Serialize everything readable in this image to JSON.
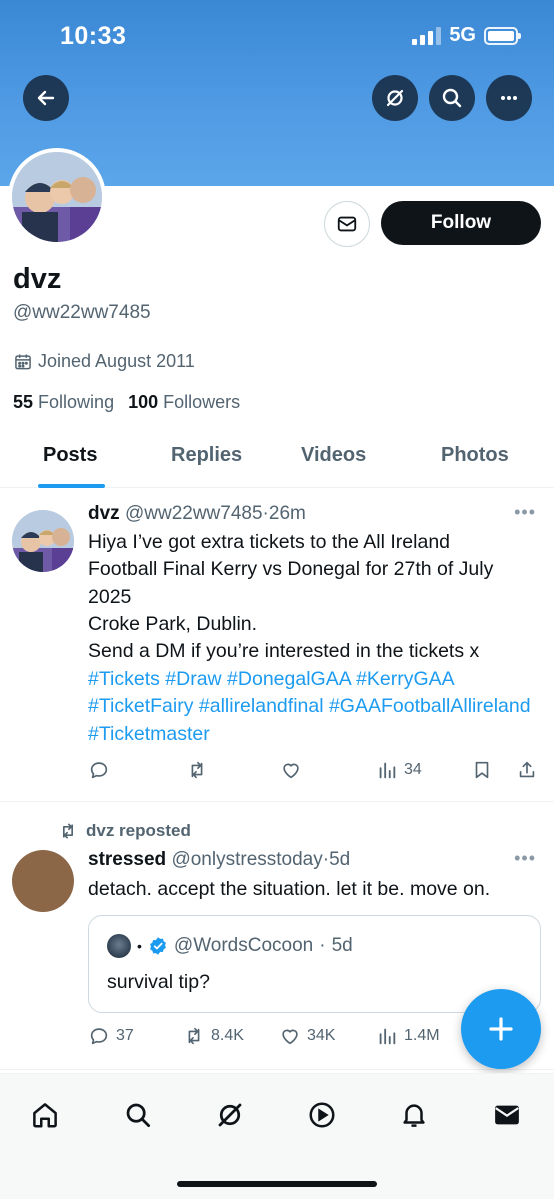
{
  "status_bar": {
    "time": "10:33",
    "network": "5G"
  },
  "header": {
    "icons": [
      "back-arrow-icon",
      "grok-icon",
      "search-icon",
      "more-icon"
    ]
  },
  "profile": {
    "name": "dvz",
    "handle": "@ww22ww7485",
    "joined": "Joined August 2011",
    "following_count": "55",
    "following_label": "Following",
    "followers_count": "100",
    "followers_label": "Followers",
    "follow_button": "Follow"
  },
  "tabs": [
    {
      "label": "Posts",
      "active": true
    },
    {
      "label": "Replies",
      "active": false
    },
    {
      "label": "Videos",
      "active": false
    },
    {
      "label": "Photos",
      "active": false
    }
  ],
  "posts": [
    {
      "author": "dvz",
      "handle": "@ww22ww7485",
      "sep": "·",
      "time": "26m",
      "text": "Hiya I’ve got extra tickets to the All Ireland\nFootball Final Kerry vs Donegal  for 27th of July\n2025\nCroke Park, Dublin.\nSend a DM if you’re interested in the tickets x",
      "hashtags": "#Tickets #Draw #DonegalGAA #KerryGAA #TicketFairy #allirelandfinal #GAAFootballAllireland #Ticketmaster",
      "views": "34"
    },
    {
      "repost_label": "dvz reposted",
      "author": "stressed",
      "handle": "@onlystresstoday",
      "sep": "·",
      "time": "5d",
      "text": "detach. accept the situation. let it be. move on.",
      "quote": {
        "dot": "•",
        "handle": "@WordsCocoon",
        "sep": "·",
        "time": "5d",
        "text": "survival tip?"
      },
      "replies": "37",
      "reposts": "8.4K",
      "likes": "34K",
      "views": "1.4M"
    }
  ],
  "bottom_nav": [
    "home-icon",
    "search-icon",
    "grok-icon",
    "video-icon",
    "notifications-icon",
    "messages-icon"
  ],
  "colors": {
    "accent": "#1d9bf0",
    "banner": "#4f9ae3",
    "text": "#0f1419",
    "muted": "#536471"
  }
}
